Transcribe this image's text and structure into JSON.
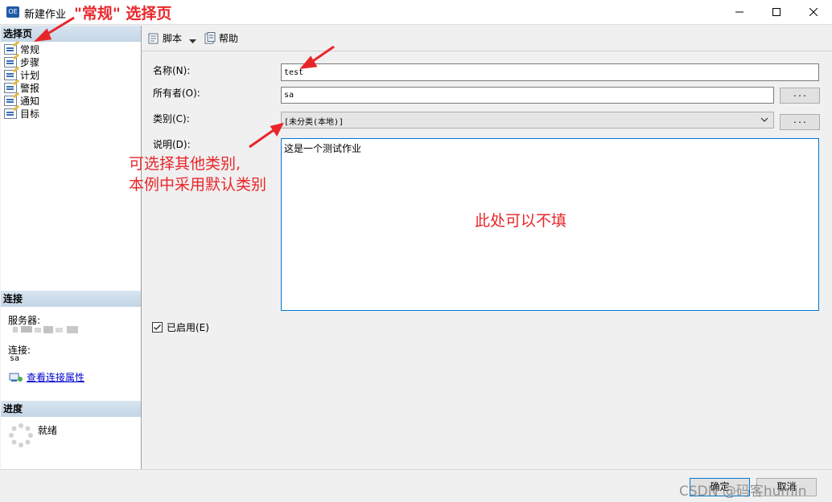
{
  "window": {
    "app_icon_text": "OE",
    "title": "新建作业"
  },
  "left": {
    "pages_header": "选择页",
    "pages": [
      "常规",
      "步骤",
      "计划",
      "警报",
      "通知",
      "目标"
    ],
    "connection_header": "连接",
    "server_label": "服务器:",
    "connection_label": "连接:",
    "connection_value": "sa",
    "view_connection_link": "查看连接属性",
    "progress_header": "进度",
    "progress_status": "就绪"
  },
  "toolbar": {
    "script_label": "脚本",
    "help_label": "帮助"
  },
  "form": {
    "name_label": "名称(N):",
    "name_value": "test",
    "owner_label": "所有者(O):",
    "owner_value": "sa",
    "owner_browse": "...",
    "category_label": "类别(C):",
    "category_value": "[未分类(本地)]",
    "category_browse": "...",
    "description_label": "说明(D):",
    "description_value": "这是一个测试作业",
    "enabled_label": "已启用(E)",
    "enabled_checked": true
  },
  "buttons": {
    "ok": "确定",
    "cancel": "取消"
  },
  "annotations": {
    "general_page": "\"常规\" 选择页",
    "category_note_line1": "可选择其他类别,",
    "category_note_line2": "本例中采用默认类别",
    "description_note": "此处可以不填",
    "watermark": "CSDN @码客humin"
  },
  "colors": {
    "annotation_red": "#e8262a",
    "section_header": "#c3d5e6",
    "link_blue": "#0000cc",
    "focus_blue": "#0078d7"
  }
}
